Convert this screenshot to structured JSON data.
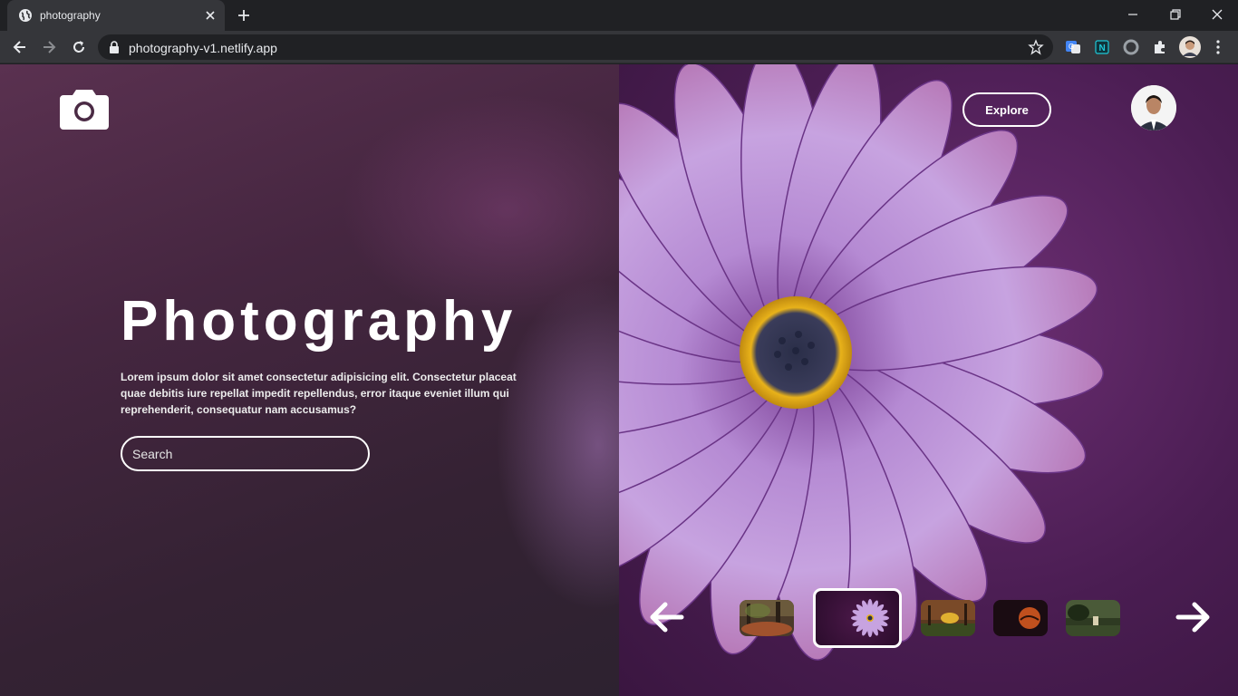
{
  "browser": {
    "tab_title": "photography",
    "url": "photography-v1.netlify.app"
  },
  "header": {
    "explore_label": "Explore"
  },
  "hero": {
    "title": "Photography",
    "description": "Lorem ipsum dolor sit amet consectetur adipisicing elit. Consectetur placeat quae debitis iure repellat impedit repellendus, error itaque eveniet illum qui reprehenderit, consequatur nam accusamus?",
    "search_placeholder": "Search"
  },
  "gallery": {
    "thumbnails": [
      "forest",
      "purple-flower",
      "sunset-field",
      "red-moon",
      "green-landscape"
    ],
    "active_index": 1
  },
  "colors": {
    "left_panel": "#3e2439",
    "flower_purple": "#a374c4",
    "flower_center": "#e8b21a"
  }
}
